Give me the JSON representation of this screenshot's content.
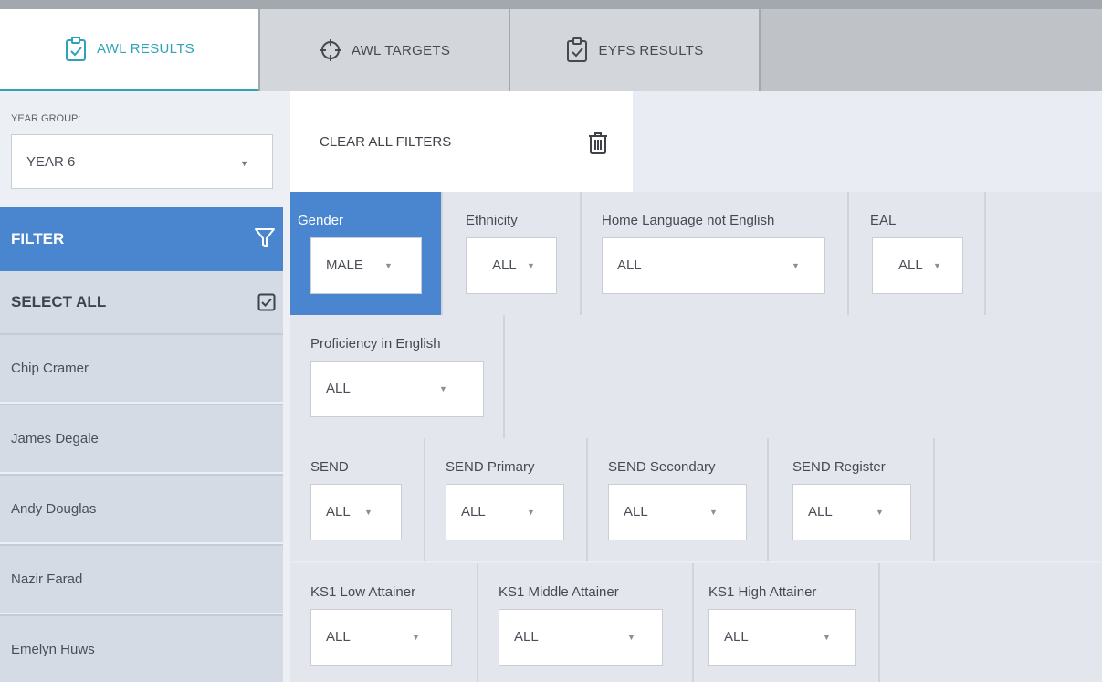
{
  "tabs": [
    {
      "label": "AWL RESULTS",
      "icon": "clipboard-check-icon",
      "active": true
    },
    {
      "label": "AWL TARGETS",
      "icon": "crosshair-icon",
      "active": false
    },
    {
      "label": "EYFS RESULTS",
      "icon": "clipboard-check-icon",
      "active": false
    }
  ],
  "sidebar": {
    "year_group_label": "YEAR GROUP:",
    "year_group_value": "YEAR 6",
    "filter_label": "FILTER",
    "select_all_label": "SELECT ALL",
    "students": [
      "Chip Cramer",
      "James Degale",
      "Andy Douglas",
      "Nazir Farad",
      "Emelyn Huws"
    ]
  },
  "main": {
    "clear_label": "CLEAR ALL FILTERS",
    "filters": {
      "gender": {
        "label": "Gender",
        "value": "MALE"
      },
      "ethnicity": {
        "label": "Ethnicity",
        "value": "ALL"
      },
      "home_language": {
        "label": "Home Language not English",
        "value": "ALL"
      },
      "eal": {
        "label": "EAL",
        "value": "ALL"
      },
      "proficiency": {
        "label": "Proficiency in English",
        "value": "ALL"
      },
      "send": {
        "label": "SEND",
        "value": "ALL"
      },
      "send_primary": {
        "label": "SEND Primary",
        "value": "ALL"
      },
      "send_secondary": {
        "label": "SEND Secondary",
        "value": "ALL"
      },
      "send_register": {
        "label": "SEND Register",
        "value": "ALL"
      },
      "ks1_low": {
        "label": "KS1 Low Attainer",
        "value": "ALL"
      },
      "ks1_middle": {
        "label": "KS1 Middle Attainer",
        "value": "ALL"
      },
      "ks1_high": {
        "label": "KS1 High Attainer",
        "value": "ALL"
      }
    }
  },
  "colors": {
    "accent": "#2ea3b8",
    "filter_blue": "#4a86cf"
  }
}
